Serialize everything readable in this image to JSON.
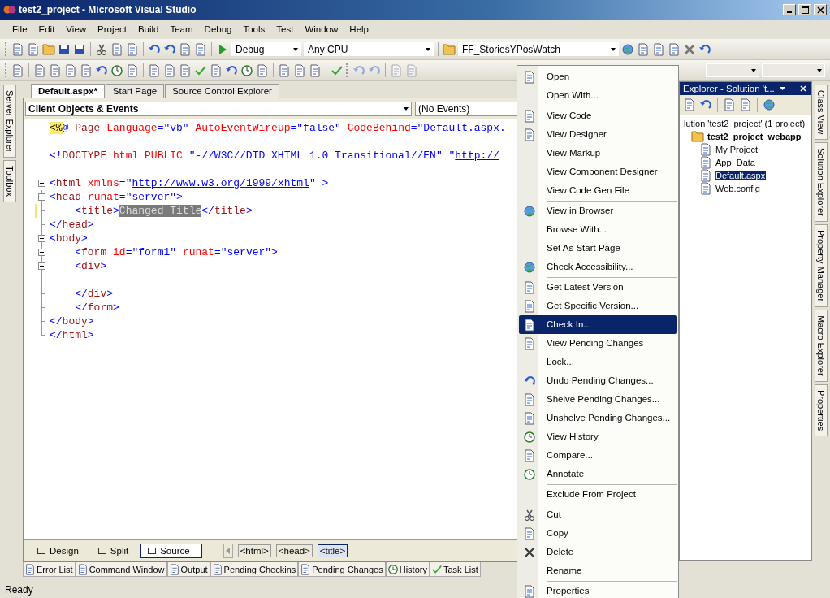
{
  "window": {
    "title": "test2_project - Microsoft Visual Studio"
  },
  "menu": [
    "File",
    "Edit",
    "View",
    "Project",
    "Build",
    "Team",
    "Debug",
    "Tools",
    "Test",
    "Window",
    "Help"
  ],
  "toolbar": {
    "configuration": "Debug",
    "platform": "Any CPU",
    "find": "FF_StoriesYPosWatch"
  },
  "left_strip": [
    "Server Explorer",
    "Toolbox"
  ],
  "document_tabs": [
    {
      "label": "Default.aspx*",
      "selected": true
    },
    {
      "label": "Start Page",
      "selected": false
    },
    {
      "label": "Source Control Explorer",
      "selected": false
    }
  ],
  "editor": {
    "objects": "Client Objects & Events",
    "events": "(No Events)",
    "lines": [
      {
        "changed": false,
        "segments": [
          {
            "kind": "directive",
            "text": "<%"
          },
          {
            "kind": "tag",
            "text": "@ "
          },
          {
            "kind": "element",
            "text": "Page "
          },
          {
            "kind": "attribute",
            "text": "Language"
          },
          {
            "kind": "tag",
            "text": "=\"vb\" "
          },
          {
            "kind": "attribute",
            "text": "AutoEventWireup"
          },
          {
            "kind": "tag",
            "text": "=\"false\" "
          },
          {
            "kind": "attribute",
            "text": "CodeBehind"
          },
          {
            "kind": "tag",
            "text": "=\"Default.aspx."
          }
        ]
      },
      {
        "changed": false
      },
      {
        "changed": false,
        "segments": [
          {
            "kind": "tag",
            "text": "<!"
          },
          {
            "kind": "element",
            "text": "DOCTYPE "
          },
          {
            "kind": "attribute",
            "text": "html PUBLIC "
          },
          {
            "kind": "tag",
            "text": "\"-//W3C//DTD XHTML 1.0 Transitional//EN\" \""
          },
          {
            "kind": "link",
            "text": "http://"
          }
        ]
      },
      {
        "changed": false
      },
      {
        "changed": false,
        "expanded": true,
        "segments": [
          {
            "kind": "tag",
            "text": "<"
          },
          {
            "kind": "element",
            "text": "html "
          },
          {
            "kind": "attribute",
            "text": "xmlns"
          },
          {
            "kind": "tag",
            "text": "=\""
          },
          {
            "kind": "link",
            "text": "http://www.w3.org/1999/xhtml"
          },
          {
            "kind": "tag",
            "text": "\" >"
          }
        ]
      },
      {
        "changed": false,
        "expanded": true,
        "segments": [
          {
            "kind": "tag",
            "text": "<"
          },
          {
            "kind": "element",
            "text": "head "
          },
          {
            "kind": "attribute",
            "text": "runat"
          },
          {
            "kind": "tag",
            "text": "=\"server\">"
          }
        ]
      },
      {
        "changed": true,
        "segments": [
          {
            "kind": "tag",
            "text": "    <"
          },
          {
            "kind": "element",
            "text": "title"
          },
          {
            "kind": "tag",
            "text": ">"
          },
          {
            "kind": "selection",
            "text": "Changed Title"
          },
          {
            "kind": "tag",
            "text": "</"
          },
          {
            "kind": "element",
            "text": "title"
          },
          {
            "kind": "tag",
            "text": ">"
          }
        ]
      },
      {
        "changed": false,
        "segments": [
          {
            "kind": "tag",
            "text": "</"
          },
          {
            "kind": "element",
            "text": "head"
          },
          {
            "kind": "tag",
            "text": ">"
          }
        ]
      },
      {
        "changed": false,
        "expanded": true,
        "segments": [
          {
            "kind": "tag",
            "text": "<"
          },
          {
            "kind": "element",
            "text": "body"
          },
          {
            "kind": "tag",
            "text": ">"
          }
        ]
      },
      {
        "changed": false,
        "expanded": true,
        "segments": [
          {
            "kind": "tag",
            "text": "    <"
          },
          {
            "kind": "element",
            "text": "form "
          },
          {
            "kind": "attribute",
            "text": "id"
          },
          {
            "kind": "tag",
            "text": "=\"form1\" "
          },
          {
            "kind": "attribute",
            "text": "runat"
          },
          {
            "kind": "tag",
            "text": "=\"server\">"
          }
        ]
      },
      {
        "changed": false,
        "expanded": true,
        "segments": [
          {
            "kind": "tag",
            "text": "    <"
          },
          {
            "kind": "element",
            "text": "div"
          },
          {
            "kind": "tag",
            "text": ">"
          }
        ]
      },
      {
        "changed": false
      },
      {
        "changed": false,
        "segments": [
          {
            "kind": "tag",
            "text": "    </"
          },
          {
            "kind": "element",
            "text": "div"
          },
          {
            "kind": "tag",
            "text": ">"
          }
        ]
      },
      {
        "changed": false,
        "segments": [
          {
            "kind": "tag",
            "text": "    </"
          },
          {
            "kind": "element",
            "text": "form"
          },
          {
            "kind": "tag",
            "text": ">"
          }
        ]
      },
      {
        "changed": false,
        "segments": [
          {
            "kind": "tag",
            "text": "</"
          },
          {
            "kind": "element",
            "text": "body"
          },
          {
            "kind": "tag",
            "text": ">"
          }
        ]
      },
      {
        "changed": false,
        "segments": [
          {
            "kind": "tag",
            "text": "</"
          },
          {
            "kind": "element",
            "text": "html"
          },
          {
            "kind": "tag",
            "text": ">"
          }
        ]
      }
    ]
  },
  "view_tabs": [
    {
      "label": "Design",
      "selected": false
    },
    {
      "label": "Split",
      "selected": false
    },
    {
      "label": "Source",
      "selected": true
    }
  ],
  "breadcrumb": [
    {
      "label": "<html>",
      "selected": false
    },
    {
      "label": "<head>",
      "selected": false
    },
    {
      "label": "<title>",
      "selected": true
    }
  ],
  "tool_tabs": [
    "Error List",
    "Command Window",
    "Output",
    "Pending Checkins",
    "Pending Changes",
    "History",
    "Task List"
  ],
  "solution_explorer": {
    "title": "Explorer - Solution 't...",
    "tree": [
      {
        "label": "lution 'test2_project' (1 project)",
        "bold": false,
        "selected": false,
        "children": [
          {
            "label": "test2_project_webapp",
            "bold": true,
            "selected": false,
            "children": [
              {
                "label": "My Project",
                "bold": false,
                "selected": false
              },
              {
                "label": "App_Data",
                "bold": false,
                "selected": false
              },
              {
                "label": "Default.aspx",
                "bold": false,
                "selected": true
              },
              {
                "label": "Web.config",
                "bold": false,
                "selected": false
              }
            ]
          }
        ]
      }
    ]
  },
  "right_strip": [
    "Class View",
    "Solution Explorer",
    "Property Manager",
    "Macro Explorer",
    "Properties"
  ],
  "context_menu": {
    "groups": [
      [
        {
          "label": "Open",
          "selected": false
        },
        {
          "label": "Open With...",
          "selected": false
        }
      ],
      [
        {
          "label": "View Code",
          "selected": false
        },
        {
          "label": "View Designer",
          "selected": false
        },
        {
          "label": "View Markup",
          "selected": false
        },
        {
          "label": "View Component Designer",
          "selected": false
        },
        {
          "label": "View Code Gen File",
          "selected": false
        }
      ],
      [
        {
          "label": "View in Browser",
          "selected": false
        },
        {
          "label": "Browse With...",
          "selected": false
        },
        {
          "label": "Set As Start Page",
          "selected": false
        },
        {
          "label": "Check Accessibility...",
          "selected": false
        }
      ],
      [
        {
          "label": "Get Latest Version",
          "selected": false
        },
        {
          "label": "Get Specific Version...",
          "selected": false
        },
        {
          "label": "Check In...",
          "selected": true
        },
        {
          "label": "View Pending Changes",
          "selected": false
        },
        {
          "label": "Lock...",
          "selected": false
        },
        {
          "label": "Undo Pending Changes...",
          "selected": false
        },
        {
          "label": "Shelve Pending Changes...",
          "selected": false
        },
        {
          "label": "Unshelve Pending Changes...",
          "selected": false
        },
        {
          "label": "View History",
          "selected": false
        },
        {
          "label": "Compare...",
          "selected": false
        },
        {
          "label": "Annotate",
          "selected": false
        }
      ],
      [
        {
          "label": "Exclude From Project",
          "selected": false
        }
      ],
      [
        {
          "label": "Cut",
          "selected": false
        },
        {
          "label": "Copy",
          "selected": false
        },
        {
          "label": "Delete",
          "selected": false
        },
        {
          "label": "Rename",
          "selected": false
        }
      ],
      [
        {
          "label": "Properties",
          "selected": false
        }
      ]
    ]
  },
  "status_bar": "Ready"
}
